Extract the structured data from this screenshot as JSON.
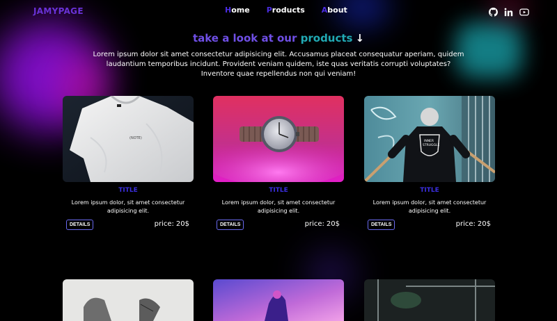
{
  "header": {
    "logo": "JAMYPAGE",
    "nav": [
      {
        "first": "H",
        "rest": "ome"
      },
      {
        "first": "P",
        "rest": "roducts"
      },
      {
        "first": "A",
        "rest": "bout"
      }
    ],
    "socials": [
      "github-icon",
      "linkedin-icon",
      "youtube-icon"
    ]
  },
  "section": {
    "title_part1": "take a look at our",
    "title_part2": "products",
    "title_arrow": "↓",
    "intro": "Lorem ipsum dolor sit amet consectetur adipisicing elit. Accusamus placeat consequatur aperiam, quidem laudantium temporibus incidunt. Provident veniam quidem, iste quas veritatis corrupti voluptates? Inventore quae repellendus non qui veniam!"
  },
  "products": [
    {
      "image": "white-tshirt",
      "title": "TITLE",
      "description": "Lorem ipsum dolor, sit amet consectetur adipisicing elit.",
      "button": "DETAILS",
      "price_label": "price:",
      "price": "20$"
    },
    {
      "image": "wristwatch",
      "title": "TITLE",
      "description": "Lorem ipsum dolor, sit amet consectetur adipisicing elit.",
      "button": "DETAILS",
      "price_label": "price:",
      "price": "20$"
    },
    {
      "image": "black-hoodie",
      "title": "TITLE",
      "description": "Lorem ipsum dolor, sit amet consectetur adipisicing elit.",
      "button": "DETAILS",
      "price_label": "price:",
      "price": "20$"
    },
    {
      "image": "sneakers"
    },
    {
      "image": "purple-product"
    },
    {
      "image": "dark-scene"
    }
  ],
  "colors": {
    "background": "#000000",
    "logo": "#6a32d8",
    "nav_accent": "#4a2de0",
    "title_purple": "#6f4fe6",
    "title_teal": "#21aab4",
    "card_title": "#3b2fe0",
    "button_border": "#6a6af0"
  }
}
